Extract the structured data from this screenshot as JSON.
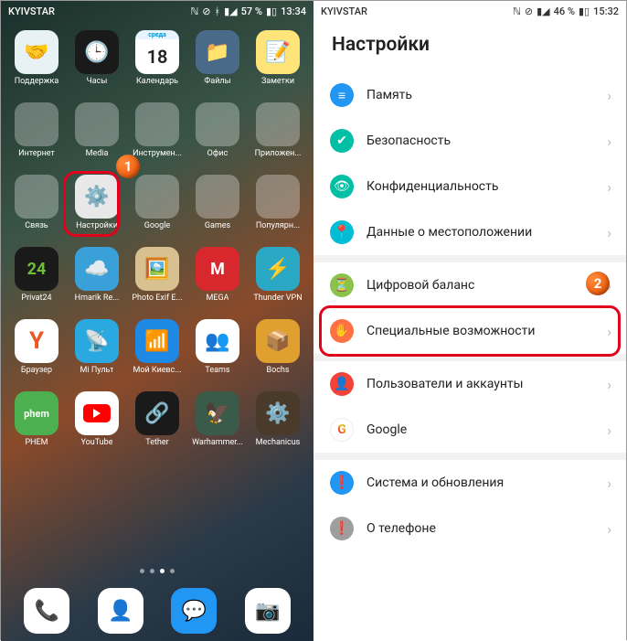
{
  "left": {
    "statusbar": {
      "carrier": "KYIVSTAR",
      "battery": "57 %",
      "time": "13:34"
    },
    "apps": [
      [
        {
          "label": "Поддержка",
          "bg": "#e8f1f4",
          "emoji": "🤝"
        },
        {
          "label": "Часы",
          "bg": "#1a1a1a",
          "emoji": "🕒"
        },
        {
          "label": "Календарь",
          "bg": "#ffffff",
          "text": "18",
          "sub": "среда"
        },
        {
          "label": "Файлы",
          "bg": "#4a6a8a",
          "emoji": "📁"
        },
        {
          "label": "Заметки",
          "bg": "#ffe47a",
          "emoji": "📝"
        }
      ],
      [
        {
          "label": "Интернет",
          "folder": [
            "#3b5998",
            "#4285f4",
            "#c43b2a",
            "#34a853",
            "#6a3a9a",
            "#e0b020",
            "#3a7ac4",
            "#ff6000",
            "#888"
          ]
        },
        {
          "label": "Media",
          "folder": [
            "#e22",
            "#3c8",
            "#26c",
            "#fa2",
            "#5c7",
            "#e4a",
            "#29c",
            "#c92",
            "#66a"
          ]
        },
        {
          "label": "Инструмен...",
          "folder": [
            "#4a9",
            "#c44",
            "#29c",
            "#fa0",
            "#3a6",
            "#888",
            "#4af",
            "#e73",
            "#2cc"
          ]
        },
        {
          "label": "Офис",
          "folder": [
            "#2b579a",
            "#217346",
            "#b7472a",
            "#d83b01",
            "#444",
            "#28a",
            "#888",
            "#7b2",
            "#b33"
          ]
        },
        {
          "label": "Приложен...",
          "folder": [
            "#0d6",
            "#e44",
            "#28e",
            "#fa3",
            "#6c3",
            "#a3e",
            "#888",
            "#e72",
            "#2cc"
          ]
        }
      ],
      [
        {
          "label": "Связь",
          "folder": [
            "#0088cc",
            "#25d366",
            "#7360f2",
            "#ff4500",
            "#00aff0",
            "#405de6",
            "#e60023",
            "#5865f2",
            "#888"
          ]
        },
        {
          "label": "Настройки",
          "bg": "#e8e8e8",
          "emoji": "⚙️",
          "highlighted": true
        },
        {
          "label": "Google",
          "folder": [
            "#ea4335",
            "#fbbc05",
            "#34a853",
            "#4285f4",
            "#ff0000",
            "#0f9d58",
            "#db4437",
            "#4285f4",
            "#888"
          ]
        },
        {
          "label": "Games",
          "folder": [
            "#333",
            "#5a9",
            "#e33",
            "#fa3",
            "#37c",
            "#8a2",
            "#c3a",
            "#29c",
            "#6c3"
          ]
        },
        {
          "label": "Популярн...",
          "folder": [
            "#e44",
            "#3a9",
            "#26c",
            "#fa0",
            "#6c3",
            "#a3e",
            "#888",
            "#e72",
            "#2cc"
          ]
        }
      ],
      [
        {
          "label": "Privat24",
          "bg": "#1a1a1a",
          "text": "24",
          "green": true
        },
        {
          "label": "Hmarik Re...",
          "bg": "#3aa0d8",
          "emoji": "☁️"
        },
        {
          "label": "Photo Exif E...",
          "bg": "#d8c090",
          "emoji": "🖼️"
        },
        {
          "label": "MEGA",
          "bg": "#d9272e",
          "text": "M"
        },
        {
          "label": "Thunder VPN",
          "bg": "#2aa8c4",
          "emoji": "⚡"
        }
      ],
      [
        {
          "label": "Браузер",
          "bg": "#ffffff",
          "ytext": "Y",
          "yandex": true
        },
        {
          "label": "Mi Пульт",
          "bg": "#2aa8e0",
          "emoji": "📡"
        },
        {
          "label": "Мой Киевс...",
          "bg": "#1e88e5",
          "emoji": "📶"
        },
        {
          "label": "Teams",
          "bg": "#ffffff",
          "emoji": "👥",
          "teams": true
        },
        {
          "label": "Bochs",
          "bg": "#e0a030",
          "emoji": "📦"
        }
      ],
      [
        {
          "label": "PHEM",
          "bg": "#4caf50",
          "text": "phem",
          "small": true
        },
        {
          "label": "YouTube",
          "bg": "#ffffff",
          "yt": true
        },
        {
          "label": "Tether",
          "bg": "#1a1a1a",
          "emoji": "🔗"
        },
        {
          "label": "Warhammer...",
          "bg": "#3a5a4a",
          "emoji": "🦅"
        },
        {
          "label": "Mechanicus",
          "bg": "#4a3a2a",
          "emoji": "⚙️"
        }
      ]
    ],
    "dock": [
      {
        "name": "phone",
        "bg": "#ffffff",
        "emoji": "📞",
        "color": "#4caf50"
      },
      {
        "name": "contacts",
        "bg": "#ffffff",
        "emoji": "👤",
        "color": "#2196f3"
      },
      {
        "name": "messages",
        "bg": "#2196f3",
        "emoji": "💬"
      },
      {
        "name": "camera",
        "bg": "#ffffff",
        "emoji": "📷"
      }
    ],
    "marker": "1"
  },
  "right": {
    "statusbar": {
      "carrier": "KYIVSTAR",
      "battery": "46 %",
      "time": "15:32"
    },
    "title": "Настройки",
    "groups": [
      [
        {
          "icon": "storage",
          "color": "#2196f3",
          "label": "Память"
        },
        {
          "icon": "shield",
          "color": "#00bfa5",
          "label": "Безопасность"
        },
        {
          "icon": "eye",
          "color": "#00bfa5",
          "label": "Конфиденциальность"
        },
        {
          "icon": "pin",
          "color": "#00bcd4",
          "label": "Данные о местоположении"
        }
      ],
      [
        {
          "icon": "balance",
          "color": "#8bc34a",
          "label": "Цифровой баланс"
        },
        {
          "icon": "hand",
          "color": "#ff7043",
          "label": "Специальные возможности",
          "highlighted": true
        }
      ],
      [
        {
          "icon": "user",
          "color": "#f44336",
          "label": "Пользователи и аккаунты"
        },
        {
          "icon": "google",
          "color": "#ffffff",
          "label": "Google",
          "google": true
        }
      ],
      [
        {
          "icon": "system",
          "color": "#2196f3",
          "label": "Система и обновления"
        },
        {
          "icon": "phone",
          "color": "#9e9e9e",
          "label": "О телефоне"
        }
      ]
    ],
    "marker": "2"
  }
}
